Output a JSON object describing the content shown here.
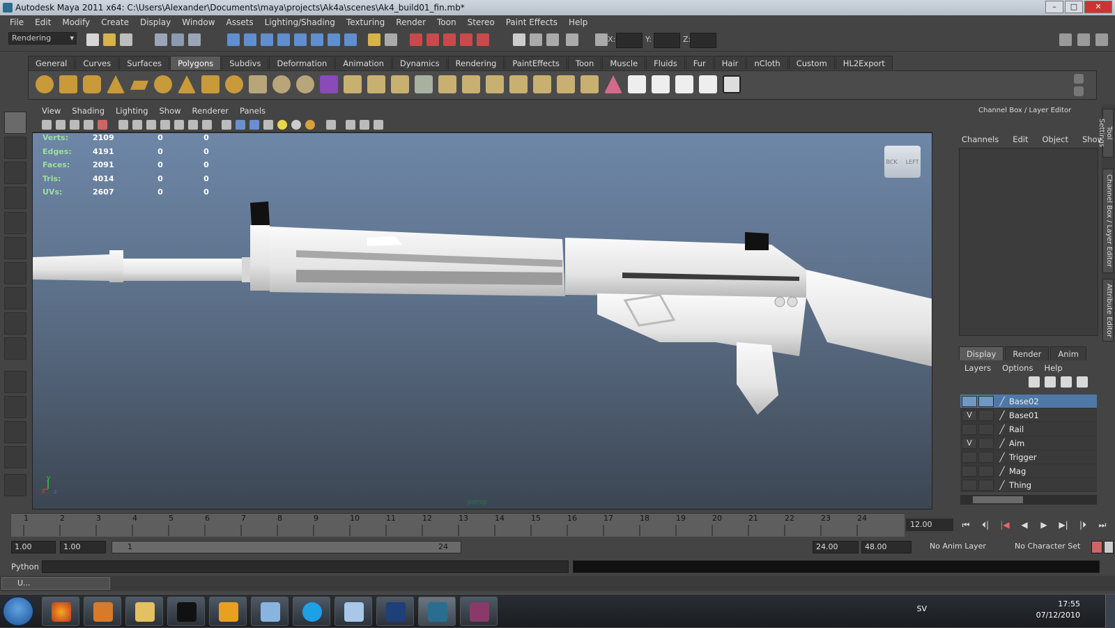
{
  "window": {
    "title": "Autodesk Maya 2011 x64: C:\\Users\\Alexander\\Documents\\maya\\projects\\Ak4a\\scenes\\Ak4_build01_fin.mb*"
  },
  "menubar": [
    "File",
    "Edit",
    "Modify",
    "Create",
    "Display",
    "Window",
    "Assets",
    "Lighting/Shading",
    "Texturing",
    "Render",
    "Toon",
    "Stereo",
    "Paint Effects",
    "Help"
  ],
  "toolbar": {
    "mode": "Rendering",
    "x_label": "X:",
    "y_label": "Y:",
    "z_label": "Z:"
  },
  "shelf_tabs": [
    "General",
    "Curves",
    "Surfaces",
    "Polygons",
    "Subdivs",
    "Deformation",
    "Animation",
    "Dynamics",
    "Rendering",
    "PaintEffects",
    "Toon",
    "Muscle",
    "Fluids",
    "Fur",
    "Hair",
    "nCloth",
    "Custom",
    "HL2Export"
  ],
  "shelf_active": "Polygons",
  "panel_menu": [
    "View",
    "Shading",
    "Lighting",
    "Show",
    "Renderer",
    "Panels"
  ],
  "hud": [
    {
      "label": "Verts:",
      "a": "2109",
      "b": "0",
      "c": "0"
    },
    {
      "label": "Edges:",
      "a": "4191",
      "b": "0",
      "c": "0"
    },
    {
      "label": "Faces:",
      "a": "2091",
      "b": "0",
      "c": "0"
    },
    {
      "label": "Tris:",
      "a": "4014",
      "b": "0",
      "c": "0"
    },
    {
      "label": "UVs:",
      "a": "2607",
      "b": "0",
      "c": "0"
    }
  ],
  "viewcube": {
    "front": "BCK",
    "side": "LEFT"
  },
  "camera_label": "persp",
  "axes": {
    "x": "x",
    "y": "y",
    "z": "z"
  },
  "right_panel": {
    "header": "Channel Box / Layer Editor",
    "cb_menu": [
      "Channels",
      "Edit",
      "Object",
      "Show"
    ],
    "side_tabs": [
      "Tool Settings",
      "Channel Box / Layer Editor",
      "Attribute Editor"
    ],
    "layer_tabs": [
      "Display",
      "Render",
      "Anim"
    ],
    "layer_menu": [
      "Layers",
      "Options",
      "Help"
    ],
    "layers": [
      {
        "name": "Base02",
        "v": "",
        "selected": true
      },
      {
        "name": "Base01",
        "v": "V",
        "selected": false
      },
      {
        "name": "Rail",
        "v": "",
        "selected": false
      },
      {
        "name": "Aim",
        "v": "V",
        "selected": false
      },
      {
        "name": "Trigger",
        "v": "",
        "selected": false
      },
      {
        "name": "Mag",
        "v": "",
        "selected": false
      },
      {
        "name": "Thing",
        "v": "",
        "selected": false
      }
    ]
  },
  "timeline": {
    "frames": [
      "1",
      "2",
      "3",
      "4",
      "5",
      "6",
      "7",
      "8",
      "9",
      "10",
      "11",
      "12",
      "13",
      "14",
      "15",
      "16",
      "17",
      "18",
      "19",
      "20",
      "21",
      "22",
      "23",
      "24"
    ],
    "current": "12.00"
  },
  "range": {
    "start": "1.00",
    "start2": "1.00",
    "slider_start": "1",
    "slider_end": "24",
    "end": "24.00",
    "end2": "48.00",
    "anim_layer": "No Anim Layer",
    "char_set": "No Character Set"
  },
  "cmdline": {
    "label": "Python"
  },
  "min_window": {
    "label": "U..."
  },
  "taskbar": {
    "lang": "SV",
    "time": "17:55",
    "date": "07/12/2010"
  },
  "colors": {
    "viewport_top": "#6e87a7",
    "viewport_bottom": "#3c4652",
    "selection": "#4e78a8",
    "hud_label": "#9de09d"
  }
}
